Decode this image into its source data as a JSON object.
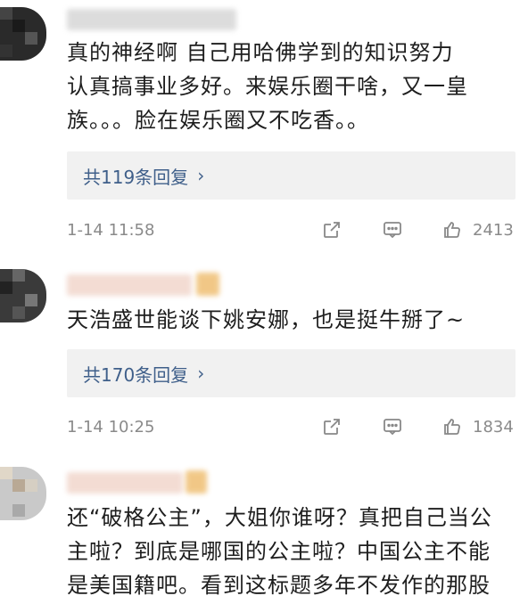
{
  "comments": [
    {
      "text_lines": [
        "真的神经啊 自己用哈佛学到的知识努力",
        "认真搞事业多好。来娱乐圈干啥，又一皇",
        "族。。。脸在娱乐圈又不吃香。。"
      ],
      "replies_label": "共119条回复",
      "time": "1-14 11:58",
      "likes": "2413"
    },
    {
      "text_lines": [
        "天浩盛世能谈下姚安娜，也是挺牛掰了~"
      ],
      "replies_label": "共170条回复",
      "time": "1-14 10:25",
      "likes": "1834"
    },
    {
      "text_lines": [
        "还“破格公主”，大姐你谁呀？真把自己当公",
        "主啦？到底是哪国的公主啦？中国公主不能",
        "是美国籍吧。看到这标题多年不发作的那股"
      ]
    }
  ],
  "icons": {
    "share": "share-icon",
    "reply": "comment-icon",
    "like": "thumbs-up-icon",
    "chevron": "chevron-right-icon"
  },
  "colors": {
    "link": "#3f5f8a",
    "meta": "#8a8a8a",
    "reply_bg": "#f1f1f1"
  }
}
